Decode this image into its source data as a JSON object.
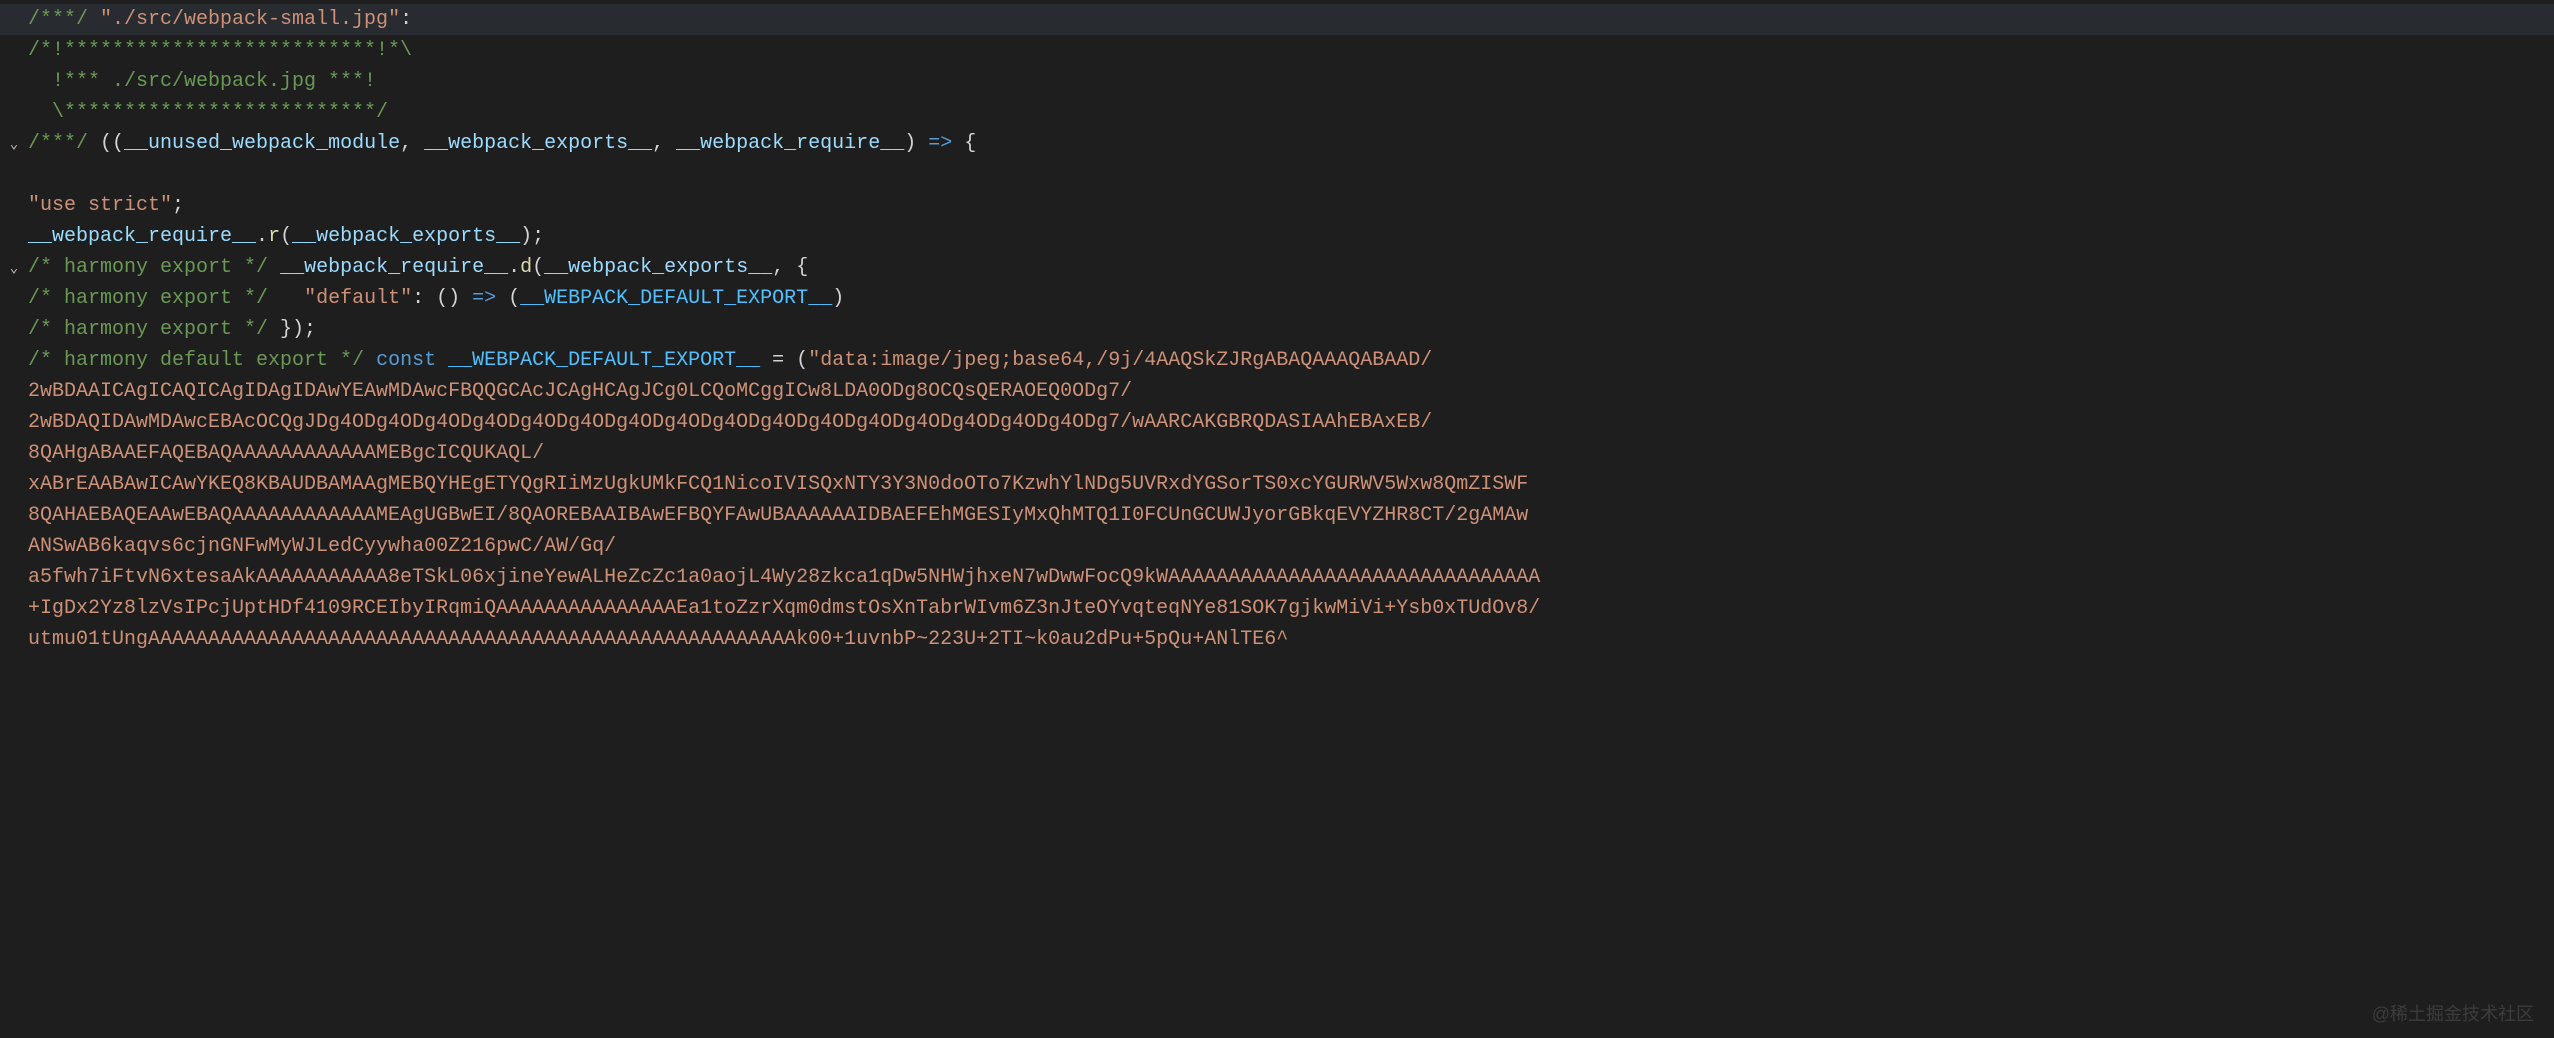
{
  "lines": [
    {
      "gutter": "",
      "segments": [
        {
          "cls": "c-comment",
          "t": "/***/ "
        },
        {
          "cls": "c-string",
          "t": "\"./src/webpack-small.jpg\""
        },
        {
          "cls": "c-white",
          "t": ":"
        }
      ],
      "highlight": true
    },
    {
      "gutter": "",
      "segments": [
        {
          "cls": "c-comment",
          "t": "/*!**************************!*\\"
        }
      ]
    },
    {
      "gutter": "",
      "segments": [
        {
          "cls": "c-comment",
          "t": "  !*** ./src/webpack.jpg ***!"
        }
      ]
    },
    {
      "gutter": "",
      "segments": [
        {
          "cls": "c-comment",
          "t": "  \\**************************/"
        }
      ]
    },
    {
      "gutter": "fold",
      "segments": [
        {
          "cls": "c-comment",
          "t": "/***/ "
        },
        {
          "cls": "c-punct",
          "t": "(("
        },
        {
          "cls": "c-param",
          "t": "__unused_webpack_module"
        },
        {
          "cls": "c-punct",
          "t": ", "
        },
        {
          "cls": "c-param",
          "t": "__webpack_exports__"
        },
        {
          "cls": "c-punct",
          "t": ", "
        },
        {
          "cls": "c-param",
          "t": "__webpack_require__"
        },
        {
          "cls": "c-punct",
          "t": ") "
        },
        {
          "cls": "c-arrow",
          "t": "=>"
        },
        {
          "cls": "c-punct",
          "t": " {"
        }
      ]
    },
    {
      "gutter": "",
      "segments": []
    },
    {
      "gutter": "",
      "segments": [
        {
          "cls": "c-string",
          "t": "\"use strict\""
        },
        {
          "cls": "c-punct",
          "t": ";"
        }
      ]
    },
    {
      "gutter": "",
      "segments": [
        {
          "cls": "c-key",
          "t": "__webpack_require__"
        },
        {
          "cls": "c-punct",
          "t": "."
        },
        {
          "cls": "c-yellow",
          "t": "r"
        },
        {
          "cls": "c-punct",
          "t": "("
        },
        {
          "cls": "c-key",
          "t": "__webpack_exports__"
        },
        {
          "cls": "c-punct",
          "t": ");"
        }
      ]
    },
    {
      "gutter": "fold",
      "segments": [
        {
          "cls": "c-comment",
          "t": "/* harmony export */"
        },
        {
          "cls": "c-punct",
          "t": " "
        },
        {
          "cls": "c-key",
          "t": "__webpack_require__"
        },
        {
          "cls": "c-punct",
          "t": "."
        },
        {
          "cls": "c-yellow",
          "t": "d"
        },
        {
          "cls": "c-punct",
          "t": "("
        },
        {
          "cls": "c-key",
          "t": "__webpack_exports__"
        },
        {
          "cls": "c-punct",
          "t": ", {"
        }
      ]
    },
    {
      "gutter": "",
      "segments": [
        {
          "cls": "c-comment",
          "t": "/* harmony export */"
        },
        {
          "cls": "c-punct",
          "t": "   "
        },
        {
          "cls": "c-string",
          "t": "\"default\""
        },
        {
          "cls": "c-punct",
          "t": ": () "
        },
        {
          "cls": "c-arrow",
          "t": "=>"
        },
        {
          "cls": "c-punct",
          "t": " ("
        },
        {
          "cls": "c-const",
          "t": "__WEBPACK_DEFAULT_EXPORT__"
        },
        {
          "cls": "c-punct",
          "t": ")"
        }
      ]
    },
    {
      "gutter": "",
      "segments": [
        {
          "cls": "c-comment",
          "t": "/* harmony export */"
        },
        {
          "cls": "c-punct",
          "t": " });"
        }
      ]
    },
    {
      "gutter": "",
      "segments": [
        {
          "cls": "c-comment",
          "t": "/* harmony default export */"
        },
        {
          "cls": "c-punct",
          "t": " "
        },
        {
          "cls": "c-keyblue",
          "t": "const"
        },
        {
          "cls": "c-punct",
          "t": " "
        },
        {
          "cls": "c-const",
          "t": "__WEBPACK_DEFAULT_EXPORT__"
        },
        {
          "cls": "c-punct",
          "t": " = ("
        },
        {
          "cls": "c-string",
          "t": "\"data:image/jpeg;base64,/9j/4AAQSkZJRgABAQAAAQABAAD/"
        }
      ]
    },
    {
      "gutter": "",
      "segments": [
        {
          "cls": "c-string",
          "t": "2wBDAAICAgICAQICAgIDAgIDAwYEAwMDAwcFBQQGCAcJCAgHCAgJCg0LCQoMCggICw8LDA0ODg8OCQsQERAOEQ0ODg7/"
        }
      ]
    },
    {
      "gutter": "",
      "segments": [
        {
          "cls": "c-string",
          "t": "2wBDAQIDAwMDAwcEBAcOCQgJDg4ODg4ODg4ODg4ODg4ODg4ODg4ODg4ODg4ODg4ODg4ODg4ODg4ODg4ODg4ODg4ODg7/wAARCAKGBRQDASIAAhEBAxEB/"
        }
      ]
    },
    {
      "gutter": "",
      "segments": [
        {
          "cls": "c-string",
          "t": "8QAHgABAAEFAQEBAQAAAAAAAAAAAAMEBgcICQUKAQL/"
        }
      ]
    },
    {
      "gutter": "",
      "segments": [
        {
          "cls": "c-string",
          "t": "xABrEAABAwICAwYKEQ8KBAUDBAMAAgMEBQYHEgETYQgRIiMzUgkUMkFCQ1NicoIVISQxNTY3Y3N0doOTo7KzwhYlNDg5UVRxdYGSorTS0xcYGURWV5Wxw8QmZISWF"
        }
      ]
    },
    {
      "gutter": "",
      "segments": [
        {
          "cls": "c-string",
          "t": "8QAHAEBAQEAAwEBAQAAAAAAAAAAAAMEAgUGBwEI/8QAOREBAAIBAwEFBQYFAwUBAAAAAAIDBAEFEhMGESIyMxQhMTQ1I0FCUnGCUWJyorGBkqEVYZHR8CT/2gAMAw"
        }
      ]
    },
    {
      "gutter": "",
      "segments": [
        {
          "cls": "c-string",
          "t": "ANSwAB6kaqvs6cjnGNFwMyWJLedCyywha00Z216pwC/AW/Gq/"
        }
      ]
    },
    {
      "gutter": "",
      "segments": [
        {
          "cls": "c-string",
          "t": "a5fwh7iFtvN6xtesaAkAAAAAAAAAAA8eTSkL06xjineYewALHeZcZc1a0aojL4Wy28zkca1qDw5NHWjhxeN7wDwwFocQ9kWAAAAAAAAAAAAAAAAAAAAAAAAAAAAAAA"
        }
      ]
    },
    {
      "gutter": "",
      "segments": [
        {
          "cls": "c-string",
          "t": "+IgDx2Yz8lzVsIPcjUptHDf4109RCEIbyIRqmiQAAAAAAAAAAAAAAAEa1toZzrXqm0dmstOsXnTabrWIvm6Z3nJteOYvqteqNYe81SOK7gjkwMiVi+Ysb0xTUdOv8/"
        }
      ]
    },
    {
      "gutter": "",
      "segments": [
        {
          "cls": "c-string",
          "t": "utmu01tUngAAAAAAAAAAAAAAAAAAAAAAAAAAAAAAAAAAAAAAAAAAAAAAAAAAAAAA​k00+1uvnbP~223U+2TI~k0au2dPu+5pQu+ANlTE6^"
        }
      ]
    }
  ],
  "watermark": "@稀土掘金技术社区"
}
